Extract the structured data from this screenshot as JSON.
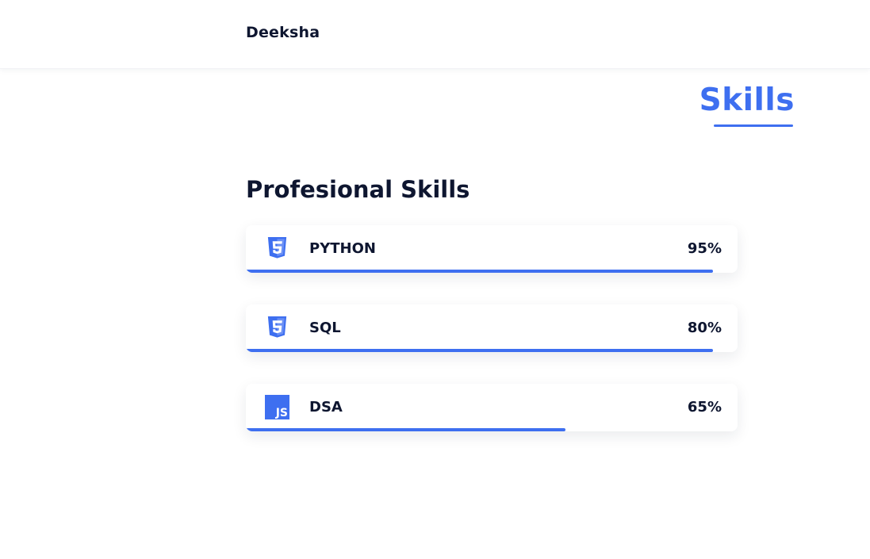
{
  "header": {
    "brand": "Deeksha"
  },
  "section": {
    "title": "Skills",
    "subtitle": "Profesional Skills"
  },
  "skills": [
    {
      "name": "PYTHON",
      "percent_label": "95%",
      "bar_fill": 0.95,
      "icon": "html5-icon"
    },
    {
      "name": "SQL",
      "percent_label": "80%",
      "bar_fill": 0.95,
      "icon": "html5-icon"
    },
    {
      "name": "DSA",
      "percent_label": "65%",
      "bar_fill": 0.65,
      "icon": "js-icon",
      "icon_text": "JS"
    }
  ],
  "colors": {
    "accent": "#3e6ff0",
    "text_dark": "#0e1630",
    "background": "#ffffff"
  }
}
